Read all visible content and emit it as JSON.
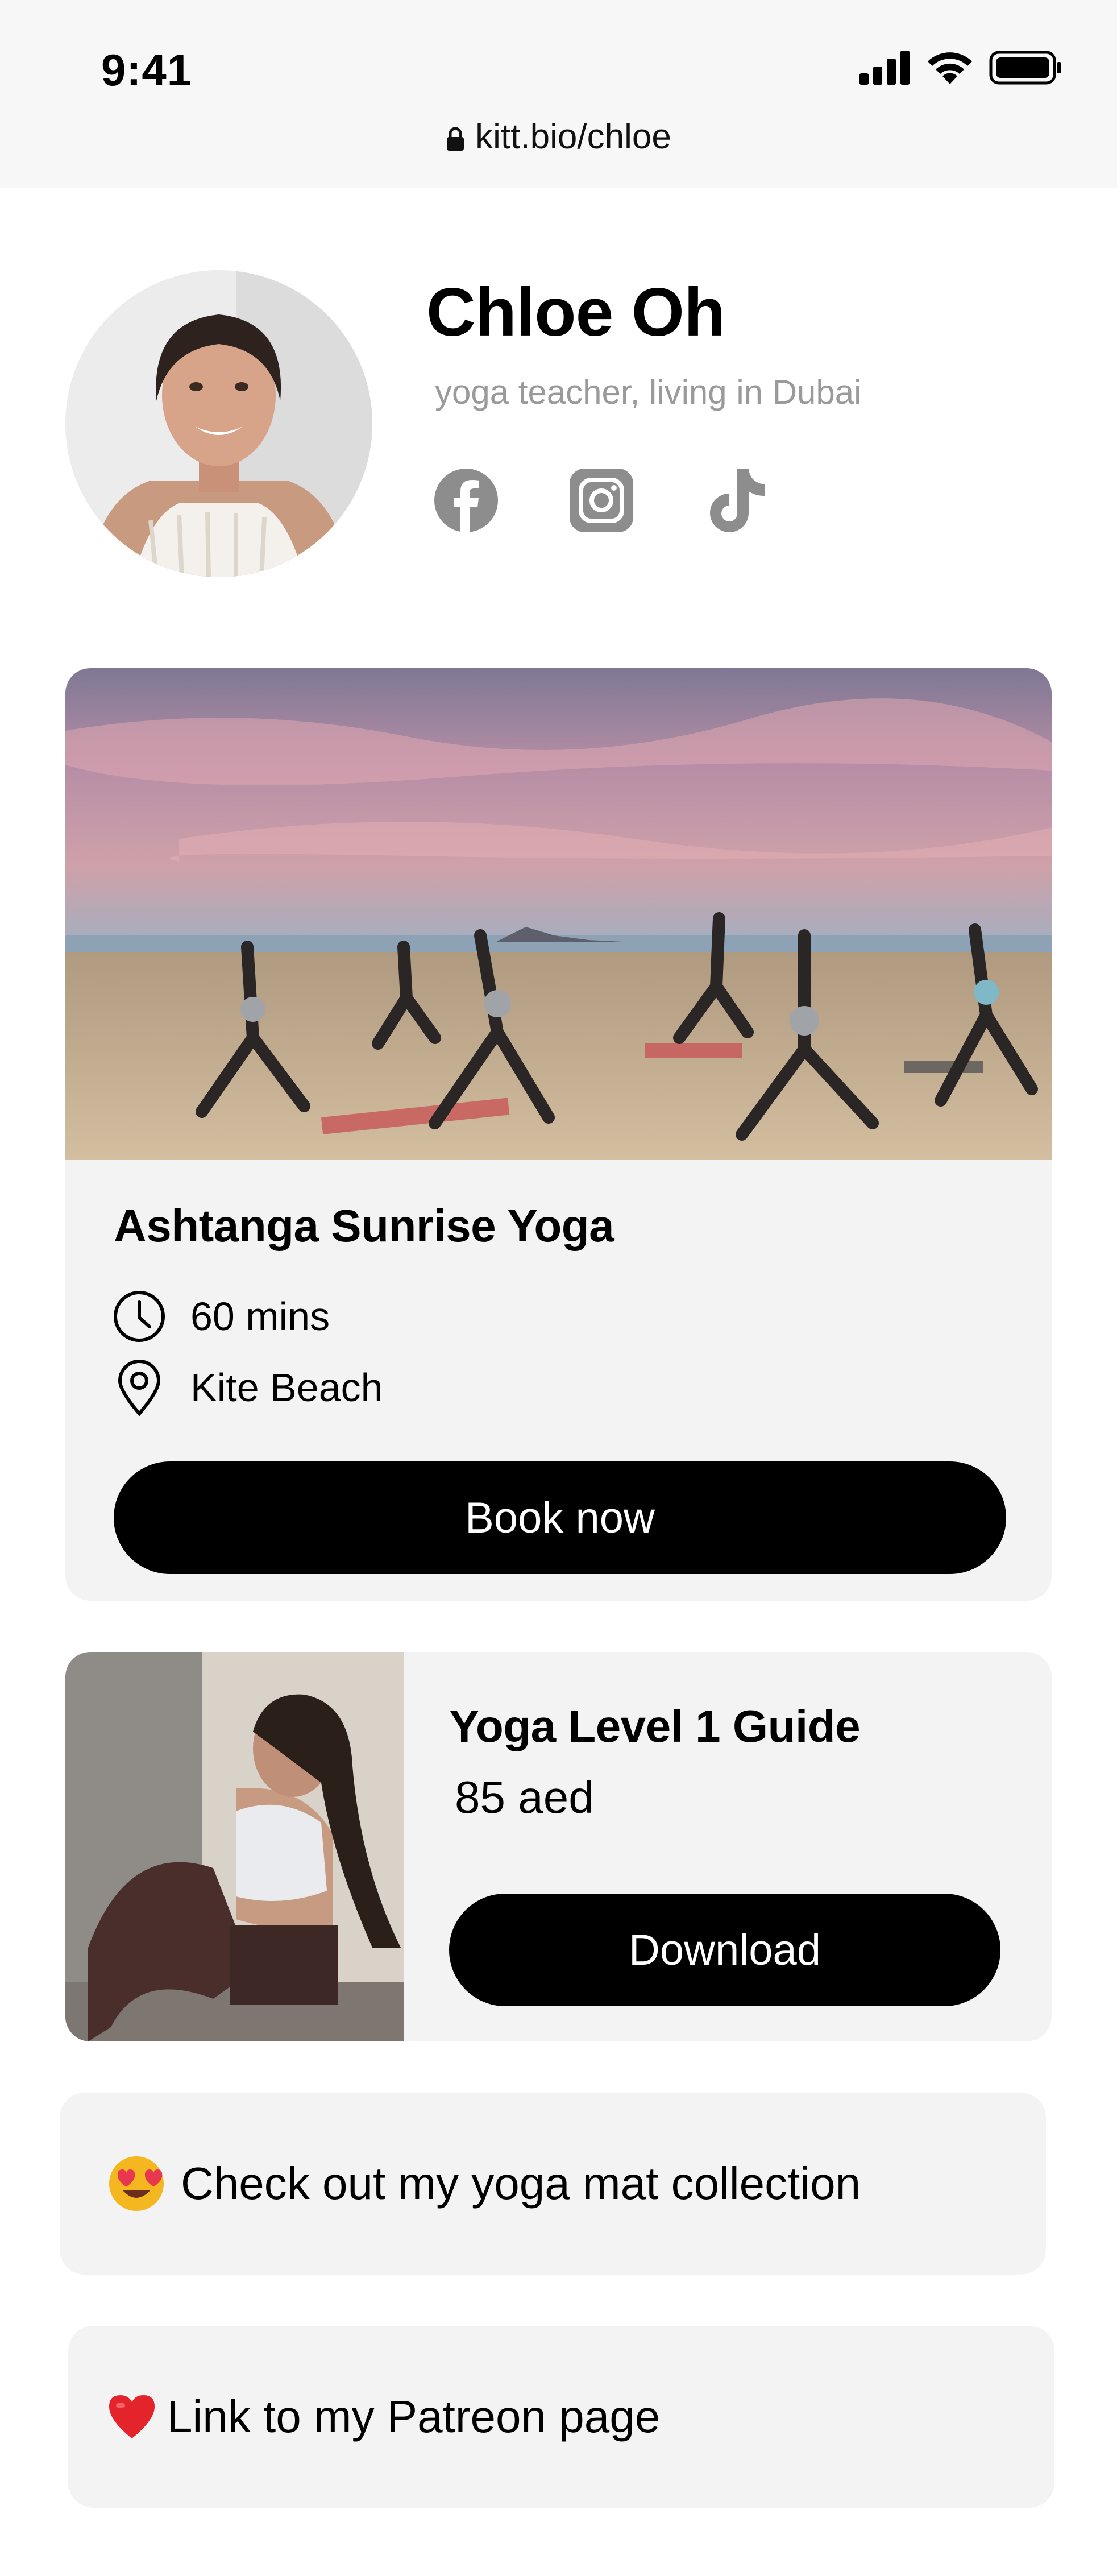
{
  "status_bar": {
    "time": "9:41",
    "url": "kitt.bio/chloe"
  },
  "profile": {
    "name": "Chloe Oh",
    "bio": "yoga teacher, living in Dubai",
    "socials": [
      "facebook-icon",
      "instagram-icon",
      "tiktok-icon"
    ]
  },
  "event": {
    "title": "Ashtanga Sunrise Yoga",
    "duration": "60 mins",
    "location": "Kite Beach",
    "button_label": "Book now"
  },
  "product": {
    "title": "Yoga Level 1 Guide",
    "price": "85 aed",
    "button_label": "Download"
  },
  "links": [
    {
      "emoji": "heart-eyes-emoji",
      "label": "Check out my yoga mat collection"
    },
    {
      "emoji": "red-heart-emoji",
      "label": "Link to my Patreon page"
    }
  ],
  "colors": {
    "accent": "#000000",
    "card_bg": "#f3f3f3",
    "muted_text": "#9a9a9a",
    "icon_gray": "#8d8d8d"
  }
}
